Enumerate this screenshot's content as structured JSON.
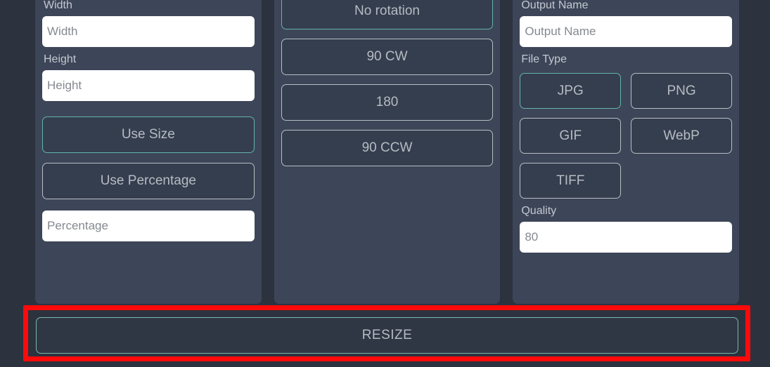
{
  "theme": {
    "page_bg": "#2c323e",
    "panel_bg": "#3d4658",
    "button_bg": "#353e4e",
    "accent_selected": "#62b4aa",
    "border_unselected": "#b9bdc4",
    "highlight": "#ff0a0a",
    "text": "#c3c8d1",
    "input_bg": "#ffffff",
    "input_text": "#6f7378"
  },
  "size_panel": {
    "width_label": "Width",
    "width_value": "",
    "width_placeholder": "Width",
    "height_label": "Height",
    "height_value": "",
    "height_placeholder": "Height",
    "mode_buttons": [
      {
        "label": "Use Size",
        "selected": true
      },
      {
        "label": "Use Percentage",
        "selected": false
      }
    ],
    "percentage_value": "",
    "percentage_placeholder": "Percentage"
  },
  "rotation_panel": {
    "buttons": [
      {
        "label": "No rotation",
        "selected": true
      },
      {
        "label": "90 CW",
        "selected": false
      },
      {
        "label": "180",
        "selected": false
      },
      {
        "label": "90 CCW",
        "selected": false
      }
    ]
  },
  "output_panel": {
    "output_name_label": "Output Name",
    "output_name_value": "",
    "output_name_placeholder": "Output Name",
    "file_type_label": "File Type",
    "file_types": [
      {
        "label": "JPG",
        "selected": true
      },
      {
        "label": "PNG",
        "selected": false
      },
      {
        "label": "GIF",
        "selected": false
      },
      {
        "label": "WebP",
        "selected": false
      },
      {
        "label": "TIFF",
        "selected": false
      }
    ],
    "quality_label": "Quality",
    "quality_value": "",
    "quality_placeholder": "80"
  },
  "action": {
    "resize_label": "RESIZE"
  }
}
